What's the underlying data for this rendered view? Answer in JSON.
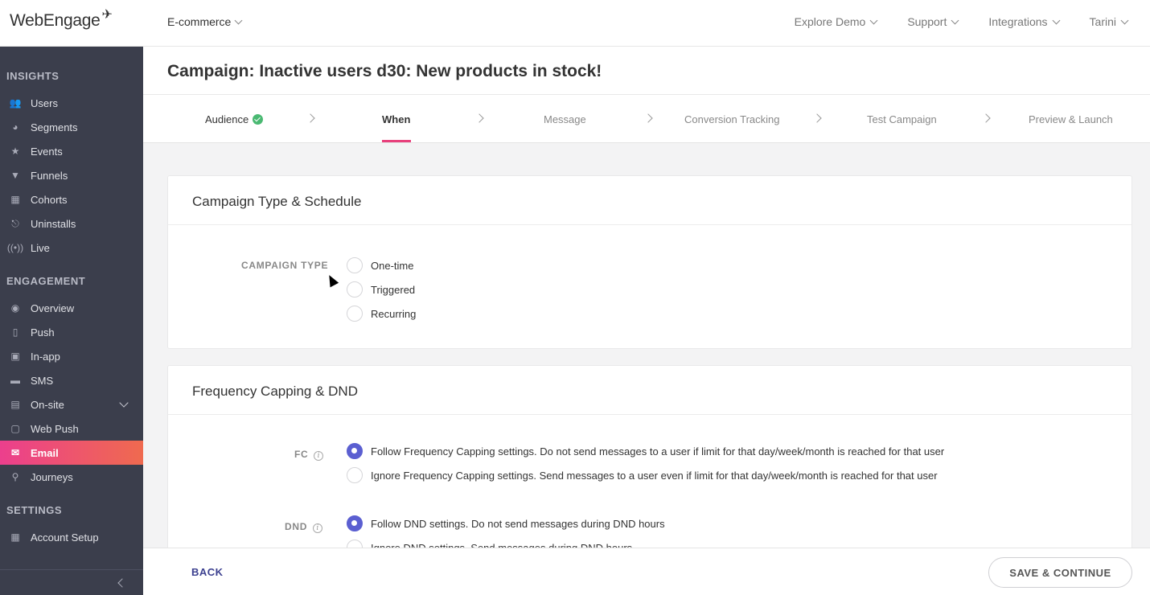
{
  "brand": {
    "logo_text": "WebEngage"
  },
  "topbar": {
    "project": "E-commerce",
    "nav": [
      "Explore Demo",
      "Support",
      "Integrations",
      "Tarini"
    ]
  },
  "sidebar": {
    "sections": [
      {
        "title": "INSIGHTS",
        "items": [
          "Users",
          "Segments",
          "Events",
          "Funnels",
          "Cohorts",
          "Uninstalls",
          "Live"
        ]
      },
      {
        "title": "ENGAGEMENT",
        "items": [
          "Overview",
          "Push",
          "In-app",
          "SMS",
          "On-site",
          "Web Push",
          "Email",
          "Journeys"
        ]
      },
      {
        "title": "SETTINGS",
        "items": [
          "Account Setup"
        ]
      }
    ],
    "active_item": "Email"
  },
  "page": {
    "title": "Campaign: Inactive users d30: New products in stock!"
  },
  "steps": [
    {
      "label": "Audience",
      "state": "done"
    },
    {
      "label": "When",
      "state": "current"
    },
    {
      "label": "Message",
      "state": "pending"
    },
    {
      "label": "Conversion Tracking",
      "state": "pending"
    },
    {
      "label": "Test Campaign",
      "state": "pending"
    },
    {
      "label": "Preview & Launch",
      "state": "pending"
    }
  ],
  "schedule_card": {
    "title": "Campaign Type & Schedule",
    "campaign_type_label": "CAMPAIGN TYPE",
    "options": [
      "One-time",
      "Triggered",
      "Recurring"
    ]
  },
  "frequency_card": {
    "title": "Frequency Capping & DND",
    "fc_label": "FC",
    "fc_options": [
      "Follow Frequency Capping settings. Do not send messages to a user if limit for that day/week/month is reached for that user",
      "Ignore Frequency Capping settings. Send messages to a user even if limit for that day/week/month is reached for that user"
    ],
    "dnd_label": "DND",
    "dnd_options": [
      "Follow DND settings. Do not send messages during DND hours",
      "Ignore DND settings. Send messages during DND hours"
    ]
  },
  "footer": {
    "back": "BACK",
    "save": "SAVE & CONTINUE"
  },
  "colors": {
    "accent": "#e8407c",
    "radio_selected": "#5b5fd1",
    "sidebar_bg": "#3b3e4c"
  }
}
